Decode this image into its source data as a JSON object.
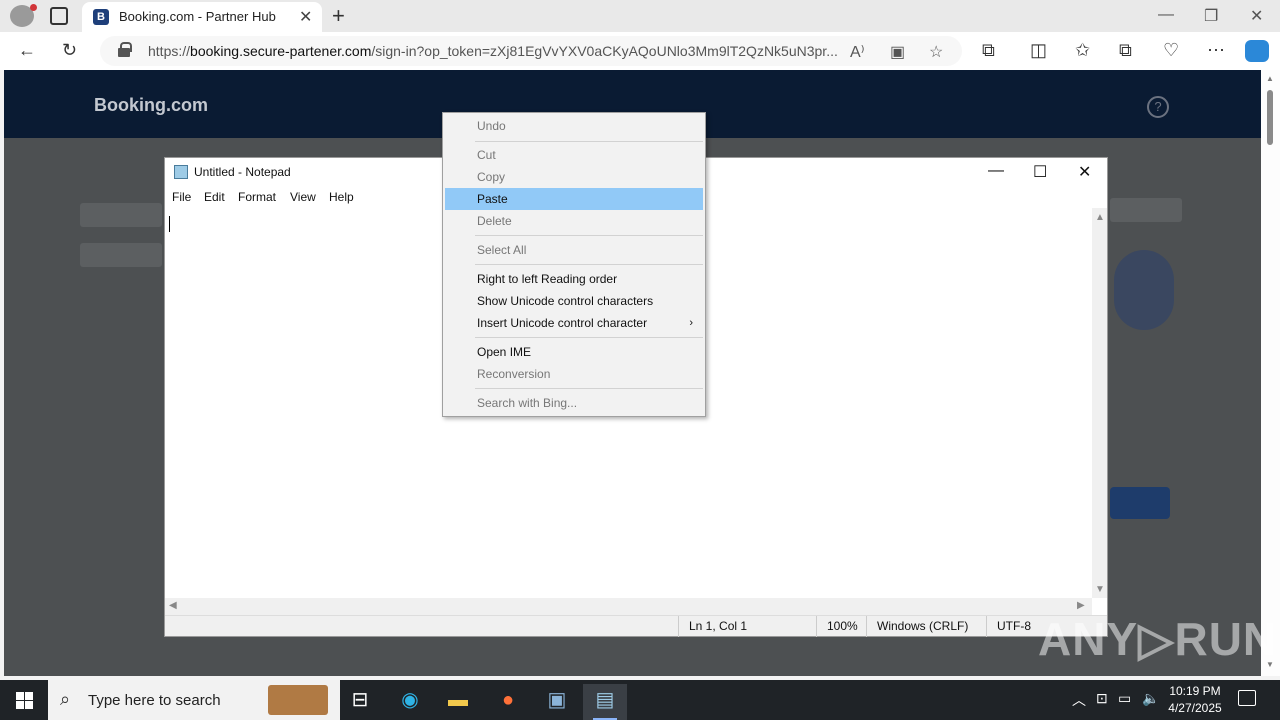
{
  "browser": {
    "tab_title": "Booking.com - Partner Hub",
    "tab_favicon_letter": "B",
    "url_prefix": "https://",
    "url_host": "booking.secure-partener.com",
    "url_path": "/sign-in?op_token=zXj81EgVvYXV0aCKyAQoUNlo3Mm9lT2QzNk5uN3pr..."
  },
  "page": {
    "logo": "Booking.com",
    "help_icon": "?"
  },
  "notepad": {
    "title": "Untitled - Notepad",
    "menu": [
      "File",
      "Edit",
      "Format",
      "View",
      "Help"
    ],
    "status": {
      "position": "Ln 1, Col 1",
      "zoom": "100%",
      "line_ending": "Windows (CRLF)",
      "encoding": "UTF-8"
    }
  },
  "context_menu": {
    "items": [
      {
        "label": "Undo",
        "disabled": true
      },
      {
        "label": "Cut",
        "disabled": true
      },
      {
        "label": "Copy",
        "disabled": true
      },
      {
        "label": "Paste",
        "highlighted": true
      },
      {
        "label": "Delete",
        "disabled": true
      },
      {
        "label": "Select All",
        "disabled": true
      },
      {
        "label": "Right to left Reading order"
      },
      {
        "label": "Show Unicode control characters"
      },
      {
        "label": "Insert Unicode control character",
        "submenu": true
      },
      {
        "label": "Open IME"
      },
      {
        "label": "Reconversion",
        "disabled": true
      },
      {
        "label": "Search with Bing...",
        "disabled": true
      }
    ]
  },
  "watermark": "ANY▷RUN",
  "taskbar": {
    "search_placeholder": "Type here to search",
    "time": "10:19 PM",
    "date": "4/27/2025"
  },
  "colors": {
    "booking_header": "#0a1b33",
    "menu_highlight": "#91c9f7",
    "taskbar": "#1f2327"
  }
}
